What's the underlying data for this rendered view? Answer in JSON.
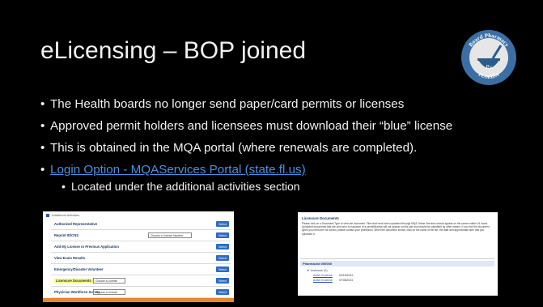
{
  "slide": {
    "title": "eLicensing – BOP joined",
    "seal": {
      "top_text": "Board Pharmacy",
      "center_text": "Rx",
      "bottom_text": "FLORIDA",
      "colors": {
        "ring": "#3a6ea5",
        "inner": "#e6e6e6",
        "mortar": "#2a5b8c"
      }
    },
    "bullets": [
      "The Health boards no longer send paper/card permits or licenses",
      "Approved permit holders and licensees must download their “blue” license",
      "This is obtained in the MQA portal (where renewals are completed).",
      "Login Option - MQAServices Portal (state.fl.us)"
    ],
    "sub_bullet": "Located under the additional activities section",
    "link_color": "#4a90e2"
  },
  "left_screenshot": {
    "header": "Additional Activities",
    "rows": [
      {
        "label": "Authorized Representative",
        "button": "Select"
      },
      {
        "label": "Reprint ID/CNS",
        "select": "Choose a License Number",
        "button": "Select"
      },
      {
        "label": "Add My License or Previous Application",
        "button": "Select"
      },
      {
        "label": "View Exam Results",
        "button": "Select"
      },
      {
        "label": "Emergency/Disaster Volunteer",
        "button": "Select"
      },
      {
        "label": "Licensure Documents",
        "select": "Choose a License",
        "button": "Select",
        "highlighted": true
      },
      {
        "label": "Physician Workforce Survey",
        "select": "Choose a License",
        "button": "Select"
      }
    ]
  },
  "right_screenshot": {
    "heading": "Licensure Documents",
    "paragraph": "Please click on a Document Type to view the document. Files that have been uploaded through MQA Online Services should appear on the screen within 24 hours. Uploaded documents that are sent prior to issuance of a permit/license will not appear on this site and should be submitted by other means. If you find the document types you need are not shown, please contact your profession. When the document shows, click on the name of the file, the date and approximate time that you uploaded it.",
    "section": "Pharmacist 000000",
    "tree_label": "Licensure (2)",
    "entries": [
      {
        "link": "Active eLicense",
        "date": "02/15/2024"
      },
      {
        "link": "Active eLicense",
        "date": "07/05/2023"
      }
    ]
  }
}
